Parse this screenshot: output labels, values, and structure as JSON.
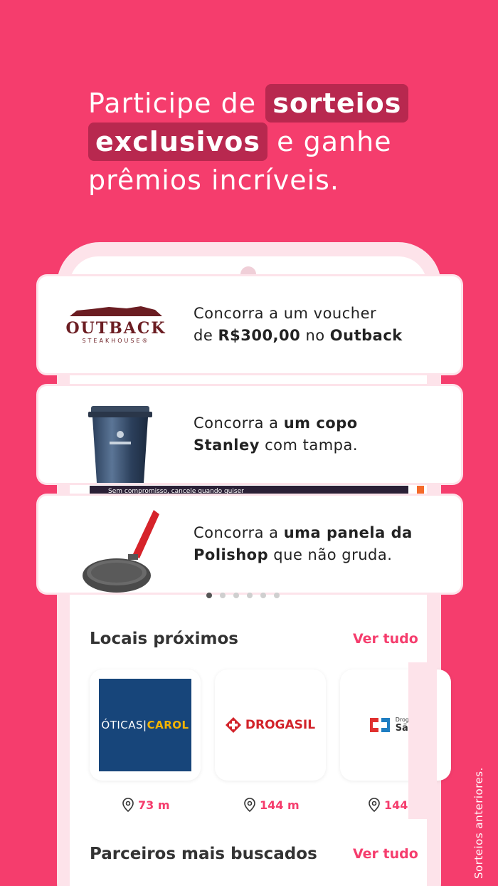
{
  "headline": {
    "pre": "Participe de",
    "hl1": "sorteios",
    "hl2": "exclusivos",
    "post": "e ganhe",
    "line3": "prêmios incríveis."
  },
  "banner_strip_text": "Sem compromisso, cancele quando quiser",
  "cards": [
    {
      "logo": "OUTBACK",
      "logo_sub": "STEAKHOUSE®",
      "t1": "Concorra a um voucher",
      "t2a": "de ",
      "t2b": "R$300,00",
      "t2c": " no ",
      "t2d": "Outback"
    },
    {
      "t1a": "Concorra a ",
      "t1b": "um copo",
      "t2a": "Stanley",
      "t2b": " com tampa."
    },
    {
      "t1a": "Concorra a ",
      "t1b": "uma panela da",
      "t2a": "Polishop",
      "t2b": " que não gruda."
    }
  ],
  "nearby": {
    "title": "Locais próximos",
    "see_all": "Ver tudo",
    "places": [
      {
        "logo_left": "ÓTICAS|",
        "logo_right": "CAROL",
        "distance": "73 m"
      },
      {
        "logo": "DROGASIL",
        "distance": "144 m"
      },
      {
        "logo_small": "Drogaria",
        "logo": "SãoP",
        "distance": "144"
      }
    ]
  },
  "partners": {
    "title": "Parceiros mais buscados",
    "see_all": "Ver tudo"
  },
  "footnote": "Sorteios anteriores.",
  "colors": {
    "brand": "#f53d6d",
    "highlight": "#b8284f"
  }
}
